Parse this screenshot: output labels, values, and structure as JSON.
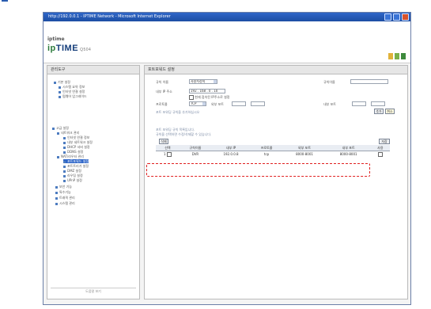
{
  "browser": {
    "title": "http://192.0.0.1 - IPTIME Network - Microsoft Internet Explorer",
    "controls": [
      "minimize",
      "maximize",
      "close"
    ]
  },
  "header": {
    "small_text": "iptime",
    "logo_main": "TIME",
    "logo_prefix": "ip",
    "logo_sub": "Q504",
    "block_colors": [
      "#e0b23a",
      "#7ab04a",
      "#3d8a3d"
    ]
  },
  "sidebar": {
    "title": "관리도구",
    "items": [
      {
        "label": "기본 설정",
        "level": 0,
        "selected": false
      },
      {
        "label": "시스템 요약 정보",
        "level": 1,
        "selected": false
      },
      {
        "label": "인터넷 연결 설정",
        "level": 1,
        "selected": false
      },
      {
        "label": "펌웨어 업그레이드",
        "level": 1,
        "selected": false
      },
      {
        "label": "고급 설정",
        "level": 0,
        "selected": false
      },
      {
        "label": "네트워크 관리",
        "level": 1,
        "selected": false
      },
      {
        "label": "인터넷 연결 정보",
        "level": 2,
        "selected": false
      },
      {
        "label": "내부 네트워크 설정",
        "level": 2,
        "selected": false
      },
      {
        "label": "DHCP 서버 설정",
        "level": 2,
        "selected": false
      },
      {
        "label": "DDNS 설정",
        "level": 2,
        "selected": false
      },
      {
        "label": "NAT/라우터 관리",
        "level": 1,
        "selected": false
      },
      {
        "label": "포트포워드 설정",
        "level": 2,
        "selected": true
      },
      {
        "label": "포트트리거 설정",
        "level": 2,
        "selected": false
      },
      {
        "label": "DMZ 설정",
        "level": 2,
        "selected": false
      },
      {
        "label": "라우팅 설정",
        "level": 2,
        "selected": false
      },
      {
        "label": "UPnP 설정",
        "level": 2,
        "selected": false
      },
      {
        "label": "보안 기능",
        "level": 1,
        "selected": false
      },
      {
        "label": "특수기능",
        "level": 1,
        "selected": false
      },
      {
        "label": "트래픽 관리",
        "level": 1,
        "selected": false
      },
      {
        "label": "시스템 관리",
        "level": 1,
        "selected": false
      }
    ],
    "footer": "도움말 보기"
  },
  "main": {
    "title": "포트포워드 설정",
    "form": {
      "rule_label": "규칙 이름",
      "rule_value": "사용자정의",
      "name_label": "규칙이름",
      "name_value": "",
      "ip_label": "내부 IP 주소",
      "ip_value": "192 . 168 . 0 . 10",
      "ip_checkbox_text": "현재 접속된 IP주소로 설정",
      "protocol_label": "프로토콜",
      "protocol_value": "TCP",
      "ext_port_label": "외부 포트",
      "int_port_label": "내부 포트",
      "help_text": "포트 포워딩 규칙을 추가하십시오",
      "add_button": "추가",
      "cancel_button": "취소"
    },
    "list": {
      "notice_1": "포트 포워딩 규칙 목록입니다.",
      "notice_2": "규칙을 선택하면 수정/삭제할 수 있습니다.",
      "delete_button": "삭제",
      "save_button": "저장",
      "columns": [
        "선택",
        "규칙이름",
        "내부 IP",
        "프로토콜",
        "외부 포트",
        "내부 포트",
        "사용"
      ],
      "rows": [
        {
          "index": "1",
          "name": "DVR",
          "ip": "192.0.0.8",
          "protocol": "tcp",
          "ext_port": "8000-8001",
          "int_port": "8000-8001",
          "checked": false
        }
      ]
    }
  }
}
